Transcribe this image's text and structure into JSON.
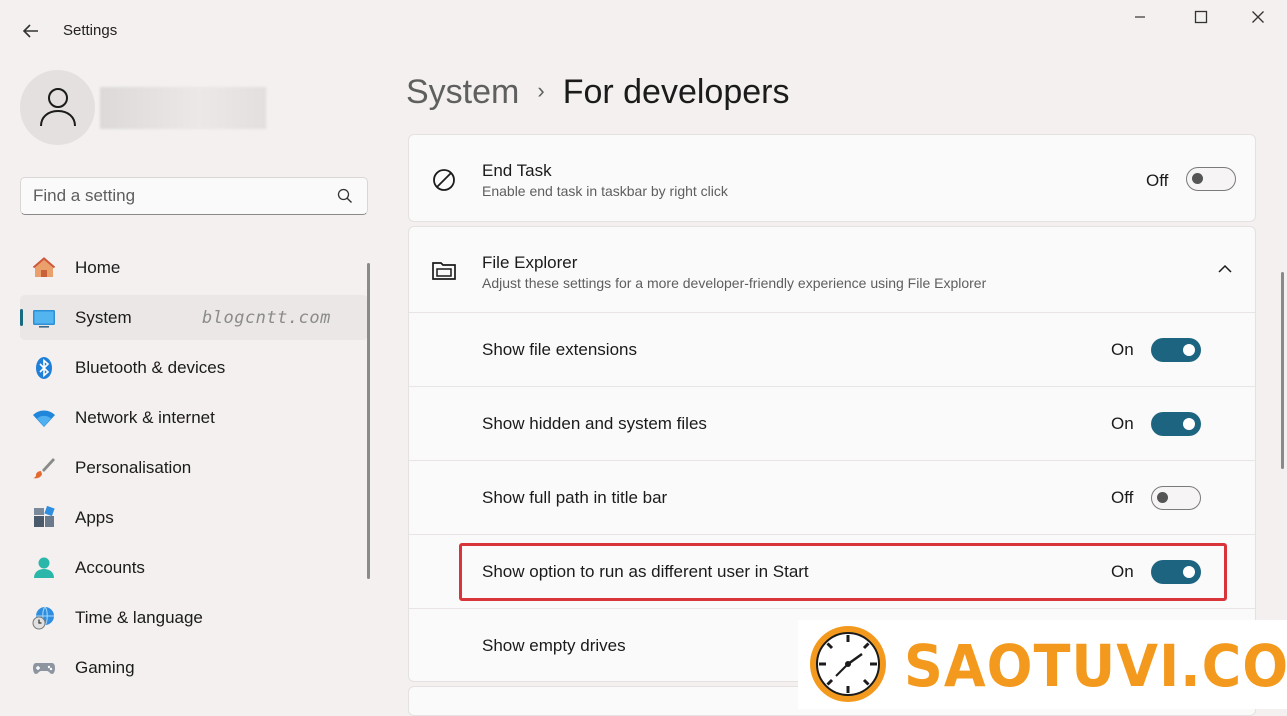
{
  "app": {
    "title": "Settings"
  },
  "window_controls": {
    "minimize": "—",
    "maximize": "☐",
    "close": "✕"
  },
  "search": {
    "placeholder": "Find a setting"
  },
  "sidebar": {
    "items": [
      {
        "label": "Home",
        "icon": "home-icon"
      },
      {
        "label": "System",
        "icon": "system-icon",
        "active": true
      },
      {
        "label": "Bluetooth & devices",
        "icon": "bluetooth-icon"
      },
      {
        "label": "Network & internet",
        "icon": "wifi-icon"
      },
      {
        "label": "Personalisation",
        "icon": "brush-icon"
      },
      {
        "label": "Apps",
        "icon": "apps-icon"
      },
      {
        "label": "Accounts",
        "icon": "accounts-icon"
      },
      {
        "label": "Time & language",
        "icon": "time-language-icon"
      },
      {
        "label": "Gaming",
        "icon": "gaming-icon"
      }
    ]
  },
  "watermark": "blogcntt.com",
  "breadcrumb": {
    "parent": "System",
    "separator": "›",
    "current": "For developers"
  },
  "end_task": {
    "title": "End Task",
    "description": "Enable end task in taskbar by right click",
    "state": "Off",
    "on": false
  },
  "file_explorer": {
    "title": "File Explorer",
    "description": "Adjust these settings for a more developer-friendly experience using File Explorer",
    "expanded": true,
    "rows": [
      {
        "label": "Show file extensions",
        "state": "On",
        "on": true
      },
      {
        "label": "Show hidden and system files",
        "state": "On",
        "on": true
      },
      {
        "label": "Show full path in title bar",
        "state": "Off",
        "on": false
      },
      {
        "label": "Show option to run as different user in Start",
        "state": "On",
        "on": true,
        "highlighted": true
      },
      {
        "label": "Show empty drives"
      }
    ]
  },
  "logo": {
    "text": "SAOTUVI.COM"
  },
  "colors": {
    "accent": "#1d6480",
    "highlight": "#d8343a",
    "logo": "#f39a1e"
  }
}
